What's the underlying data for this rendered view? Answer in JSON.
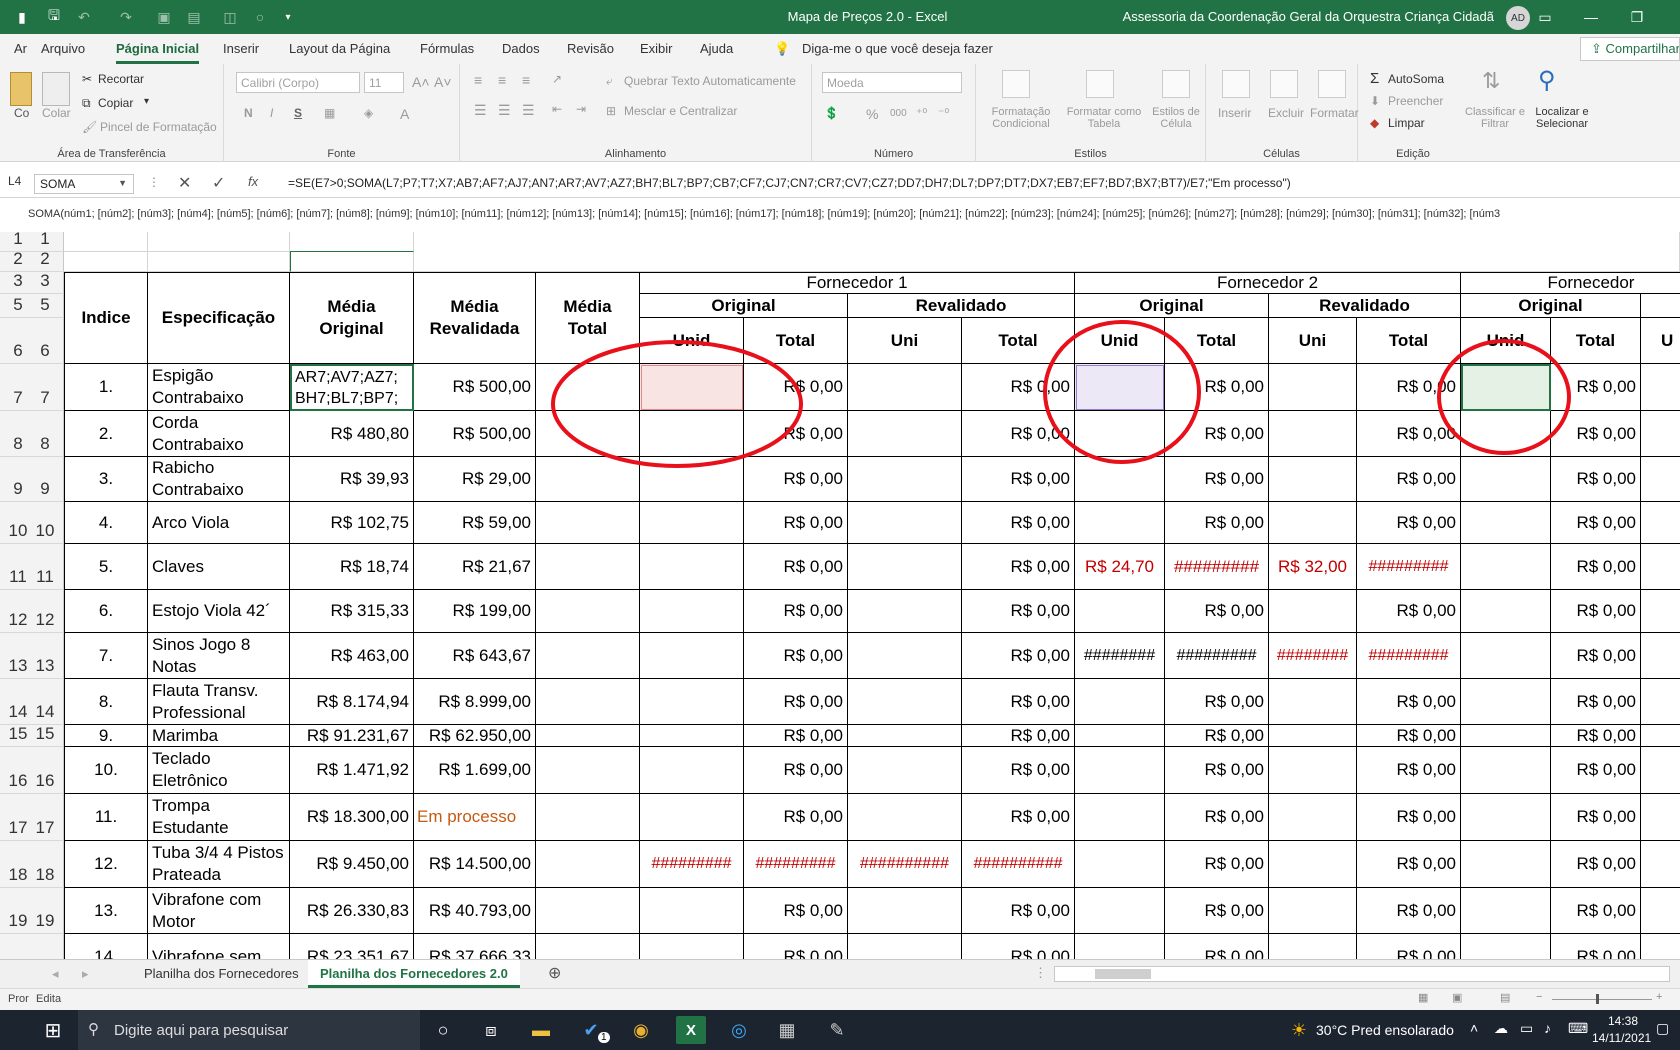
{
  "window": {
    "title": "Mapa de Preços 2.0  -  Excel",
    "account": "Assessoria da Coordenação Geral da Orquestra Criança Cidadã",
    "avatar": "AD",
    "theme_color": "#217346"
  },
  "quick_access": [
    "save-icon",
    "undo-icon",
    "redo-icon",
    "print-preview-icon",
    "form-icon",
    "camera-icon",
    "circle-icon",
    "customize-icon"
  ],
  "ribbon_tabs": [
    "Ar",
    "Arquivo",
    "Página Inicial",
    "Inserir",
    "Layout da Página",
    "Fórmulas",
    "Dados",
    "Revisão",
    "Exibir",
    "Ajuda"
  ],
  "active_tab": "Página Inicial",
  "tell_me": "Diga-me o que você deseja fazer",
  "share": "Compartilhar",
  "ribbon": {
    "clipboard": {
      "paste": "Co",
      "paste2": "Colar",
      "cut": "Recortar",
      "copy": "Copiar",
      "format_painter": "Pincel de Formatação",
      "label": "Área de Transferência"
    },
    "font": {
      "name": "Calibri (Corpo)",
      "size": "11",
      "label": "Fonte",
      "bold": "N",
      "italic": "I",
      "underline": "S"
    },
    "alignment": {
      "wrap": "Quebrar Texto Automaticamente",
      "merge": "Mesclar e Centralizar",
      "label": "Alinhamento"
    },
    "number": {
      "format": "Moeda",
      "percent": "%",
      "thousands": "000",
      "label": "Número"
    },
    "styles": {
      "conditional": "Formatação Condicional",
      "table": "Formatar como Tabela",
      "cell_styles": "Estilos de Célula",
      "label": "Estilos"
    },
    "cells": {
      "insert": "Inserir",
      "delete": "Excluir",
      "format": "Formatar",
      "label": "Células"
    },
    "editing": {
      "autosum": "AutoSoma",
      "fill": "Preencher",
      "clear": "Limpar",
      "sort": "Classificar e Filtrar",
      "find": "Localizar e Selecionar",
      "label": "Edição"
    }
  },
  "formula_bar": {
    "cell_ref": "L4",
    "name_box": "SOMA",
    "formula": "=SE(E7>0;SOMA(L7;P7;T7;X7;AB7;AF7;AJ7;AN7;AR7;AV7;AZ7;BH7;BL7;BP7;CB7;CF7;CJ7;CN7;CR7;CV7;CZ7;DD7;DH7;DL7;DP7;DT7;DX7;EB7;EF7;BD7;BX7;BT7)/E7;\"Em processo\")",
    "hint": "SOMA(núm1; [núm2]; [núm3]; [núm4]; [núm5]; [núm6]; [núm7]; [núm8]; [núm9]; [núm10]; [núm11]; [núm12]; [núm13]; [núm14]; [núm15]; [núm16]; [núm17]; [núm18]; [núm19]; [núm20]; [núm21]; [núm22]; [núm23]; [núm24]; [núm25]; [núm26]; [núm27]; [núm28]; [núm29]; [núm30]; [núm31]; [núm32]; [núm3"
  },
  "row_headers": [
    "1",
    "2",
    "3",
    "5",
    "6",
    "7",
    "8",
    "9",
    "10",
    "11",
    "12",
    "13",
    "14",
    "15",
    "16",
    "17",
    "18",
    "19"
  ],
  "headers": {
    "indice": "Indice",
    "especificacao": "Especificação",
    "media_original": "Média Original",
    "media_revalidada": "Média Revalidada",
    "media_total": "Média Total",
    "fornecedor1": "Fornecedor 1",
    "fornecedor2": "Fornecedor 2",
    "fornecedor3": "Fornecedor",
    "original": "Original",
    "revalidado": "Revalidado",
    "unid": "Unid",
    "total": "Total",
    "uni": "Uni",
    "u": "U"
  },
  "rows": [
    {
      "idx": "1.",
      "spec": "Espigão Contrabaixo",
      "orig": "AR7;AV7;AZ7; BH7;BL7;BP7;",
      "reval": "R$ 500,00",
      "f1_o_unid": "",
      "f1_o_total": "R$ 0,00",
      "f1_r_uni": "",
      "f1_r_total": "R$ 0,00",
      "f2_o_unid": "",
      "f2_o_total": "R$ 0,00",
      "f2_r_uni": "",
      "f2_r_total": "R$ 0,00",
      "f3_o_unid": "",
      "f3_o_total": "R$ 0,00"
    },
    {
      "idx": "2.",
      "spec": "Corda Contrabaixo",
      "orig": "R$ 480,80",
      "reval": "R$ 500,00",
      "f1_o_unid": "",
      "f1_o_total": "R$ 0,00",
      "f1_r_uni": "",
      "f1_r_total": "R$ 0,00",
      "f2_o_unid": "",
      "f2_o_total": "R$ 0,00",
      "f2_r_uni": "",
      "f2_r_total": "R$ 0,00",
      "f3_o_unid": "",
      "f3_o_total": "R$ 0,00"
    },
    {
      "idx": "3.",
      "spec": "Rabicho Contrabaixo",
      "orig": "R$ 39,93",
      "reval": "R$ 29,00",
      "f1_o_unid": "",
      "f1_o_total": "R$ 0,00",
      "f1_r_uni": "",
      "f1_r_total": "R$ 0,00",
      "f2_o_unid": "",
      "f2_o_total": "R$ 0,00",
      "f2_r_uni": "",
      "f2_r_total": "R$ 0,00",
      "f3_o_unid": "",
      "f3_o_total": "R$ 0,00"
    },
    {
      "idx": "4.",
      "spec": "Arco Viola",
      "orig": "R$ 102,75",
      "reval": "R$ 59,00",
      "f1_o_unid": "",
      "f1_o_total": "R$ 0,00",
      "f1_r_uni": "",
      "f1_r_total": "R$ 0,00",
      "f2_o_unid": "",
      "f2_o_total": "R$ 0,00",
      "f2_r_uni": "",
      "f2_r_total": "R$ 0,00",
      "f3_o_unid": "",
      "f3_o_total": "R$ 0,00"
    },
    {
      "idx": "5.",
      "spec": "Claves",
      "orig": "R$ 18,74",
      "reval": "R$ 21,67",
      "f1_o_unid": "",
      "f1_o_total": "R$ 0,00",
      "f1_r_uni": "",
      "f1_r_total": "R$ 0,00",
      "f2_o_unid": "R$ 24,70",
      "f2_o_total": "#########",
      "f2_r_uni": "R$ 32,00",
      "f2_r_total": "#########",
      "f3_o_unid": "",
      "f3_o_total": "R$ 0,00"
    },
    {
      "idx": "6.",
      "spec": "Estojo Viola 42´",
      "orig": "R$ 315,33",
      "reval": "R$ 199,00",
      "f1_o_unid": "",
      "f1_o_total": "R$ 0,00",
      "f1_r_uni": "",
      "f1_r_total": "R$ 0,00",
      "f2_o_unid": "",
      "f2_o_total": "R$ 0,00",
      "f2_r_uni": "",
      "f2_r_total": "R$ 0,00",
      "f3_o_unid": "",
      "f3_o_total": "R$ 0,00"
    },
    {
      "idx": "7.",
      "spec": "Sinos Jogo 8 Notas",
      "orig": "R$ 463,00",
      "reval": "R$ 643,67",
      "f1_o_unid": "",
      "f1_o_total": "R$ 0,00",
      "f1_r_uni": "",
      "f1_r_total": "R$ 0,00",
      "f2_o_unid": "########",
      "f2_o_total": "#########",
      "f2_r_uni": "########",
      "f2_r_total": "#########",
      "f3_o_unid": "",
      "f3_o_total": "R$ 0,00"
    },
    {
      "idx": "8.",
      "spec": "Flauta Transv. Professional",
      "orig": "R$ 8.174,94",
      "reval": "R$ 8.999,00",
      "f1_o_unid": "",
      "f1_o_total": "R$ 0,00",
      "f1_r_uni": "",
      "f1_r_total": "R$ 0,00",
      "f2_o_unid": "",
      "f2_o_total": "R$ 0,00",
      "f2_r_uni": "",
      "f2_r_total": "R$ 0,00",
      "f3_o_unid": "",
      "f3_o_total": "R$ 0,00"
    },
    {
      "idx": "9.",
      "spec": "Marimba",
      "orig": "R$ 91.231,67",
      "reval": "R$ 62.950,00",
      "f1_o_unid": "",
      "f1_o_total": "R$ 0,00",
      "f1_r_uni": "",
      "f1_r_total": "R$ 0,00",
      "f2_o_unid": "",
      "f2_o_total": "R$ 0,00",
      "f2_r_uni": "",
      "f2_r_total": "R$ 0,00",
      "f3_o_unid": "",
      "f3_o_total": "R$ 0,00"
    },
    {
      "idx": "10.",
      "spec": "Teclado Eletrônico",
      "orig": "R$ 1.471,92",
      "reval": "R$ 1.699,00",
      "f1_o_unid": "",
      "f1_o_total": "R$ 0,00",
      "f1_r_uni": "",
      "f1_r_total": "R$ 0,00",
      "f2_o_unid": "",
      "f2_o_total": "R$ 0,00",
      "f2_r_uni": "",
      "f2_r_total": "R$ 0,00",
      "f3_o_unid": "",
      "f3_o_total": "R$ 0,00"
    },
    {
      "idx": "11.",
      "spec": "Trompa Estudante",
      "orig": "R$ 18.300,00",
      "reval": "Em processo",
      "f1_o_unid": "",
      "f1_o_total": "R$ 0,00",
      "f1_r_uni": "",
      "f1_r_total": "R$ 0,00",
      "f2_o_unid": "",
      "f2_o_total": "R$ 0,00",
      "f2_r_uni": "",
      "f2_r_total": "R$ 0,00",
      "f3_o_unid": "",
      "f3_o_total": "R$ 0,00"
    },
    {
      "idx": "12.",
      "spec": "Tuba 3/4 4 Pistos Prateada",
      "orig": "R$ 9.450,00",
      "reval": "R$ 14.500,00",
      "f1_o_unid": "#########",
      "f1_o_total": "#########",
      "f1_r_uni": "##########",
      "f1_r_total": "##########",
      "f2_o_unid": "",
      "f2_o_total": "R$ 0,00",
      "f2_r_uni": "",
      "f2_r_total": "R$ 0,00",
      "f3_o_unid": "",
      "f3_o_total": "R$ 0,00"
    },
    {
      "idx": "13.",
      "spec": "Vibrafone com Motor",
      "orig": "R$ 26.330,83",
      "reval": "R$ 40.793,00",
      "f1_o_unid": "",
      "f1_o_total": "R$ 0,00",
      "f1_r_uni": "",
      "f1_r_total": "R$ 0,00",
      "f2_o_unid": "",
      "f2_o_total": "R$ 0,00",
      "f2_r_uni": "",
      "f2_r_total": "R$ 0,00",
      "f3_o_unid": "",
      "f3_o_total": "R$ 0,00"
    },
    {
      "idx": "14.",
      "spec": "Vibrafone sem",
      "orig": "R$ 23.351,67",
      "reval": "R$ 37.666,33",
      "f1_o_unid": "",
      "f1_o_total": "R$ 0,00",
      "f1_r_uni": "",
      "f1_r_total": "R$ 0,00",
      "f2_o_unid": "",
      "f2_o_total": "R$ 0,00",
      "f2_r_uni": "",
      "f2_r_total": "R$ 0,00",
      "f3_o_unid": "",
      "f3_o_total": "R$ 0,00"
    }
  ],
  "sheet_tabs": [
    "Planilha dos Fornecedores",
    "Planilha dos Fornecedores 2.0"
  ],
  "active_sheet": "Planilha dos Fornecedores 2.0",
  "status": {
    "prefix": "Pror",
    "mode": "Edita"
  },
  "taskbar": {
    "search_placeholder": "Digite aqui para pesquisar",
    "weather": "30°C  Pred ensolarado",
    "time": "14:38",
    "date": "14/11/2021",
    "badge": "1"
  }
}
